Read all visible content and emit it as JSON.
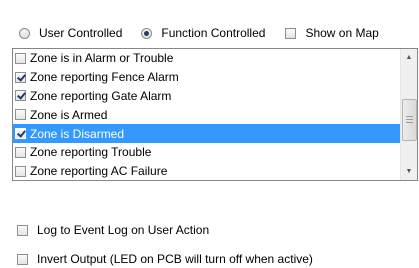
{
  "mode": {
    "user_controlled_label": "User Controlled",
    "function_controlled_label": "Function Controlled",
    "selected": "function_controlled"
  },
  "show_on_map": {
    "label": "Show on Map",
    "checked": false
  },
  "conditions": {
    "items": [
      {
        "label": "Zone is in Alarm or Trouble",
        "checked": false,
        "selected": false
      },
      {
        "label": "Zone reporting Fence Alarm",
        "checked": true,
        "selected": false
      },
      {
        "label": "Zone reporting Gate Alarm",
        "checked": true,
        "selected": false
      },
      {
        "label": "Zone is Armed",
        "checked": false,
        "selected": false
      },
      {
        "label": "Zone is Disarmed",
        "checked": true,
        "selected": true
      },
      {
        "label": "Zone reporting Trouble",
        "checked": false,
        "selected": false
      },
      {
        "label": "Zone reporting AC Failure",
        "checked": false,
        "selected": false
      }
    ]
  },
  "options": {
    "log_event": {
      "label": "Log to Event Log on User Action",
      "checked": false
    },
    "invert_output": {
      "label": "Invert Output (LED on PCB will turn off when active)",
      "checked": false
    }
  }
}
